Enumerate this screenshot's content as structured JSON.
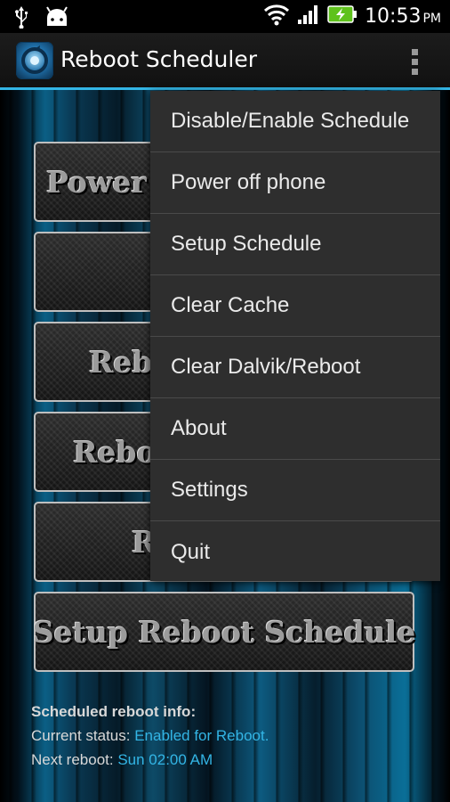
{
  "status_bar": {
    "time": "10:53",
    "ampm": "PM",
    "icons": [
      "usb-icon",
      "android-icon",
      "wifi-icon",
      "signal-icon",
      "battery-charging-icon"
    ],
    "battery_color": "#5fc21c"
  },
  "action_bar": {
    "title": "Reboot Scheduler",
    "accent": "#33b5e5",
    "icon": "reboot-scheduler-app-icon",
    "overflow_icon": "overflow-menu-icon"
  },
  "main": {
    "buttons": [
      {
        "label": "Power"
      },
      {
        "label": ""
      },
      {
        "label": "Reb"
      },
      {
        "label": "Rebo"
      },
      {
        "label": "R"
      },
      {
        "label": "Setup Reboot Schedule"
      }
    ]
  },
  "info": {
    "heading": "Scheduled reboot info:",
    "status_label": "Current status: ",
    "status_value": "Enabled for Reboot.",
    "next_label": "Next reboot: ",
    "next_value": "Sun 02:00 AM"
  },
  "overflow_menu": {
    "items": [
      {
        "label": "Disable/Enable Schedule"
      },
      {
        "label": "Power off phone"
      },
      {
        "label": "Setup Schedule"
      },
      {
        "label": "Clear Cache"
      },
      {
        "label": "Clear Dalvik/Reboot"
      },
      {
        "label": "About"
      },
      {
        "label": "Settings"
      },
      {
        "label": "Quit"
      }
    ]
  }
}
